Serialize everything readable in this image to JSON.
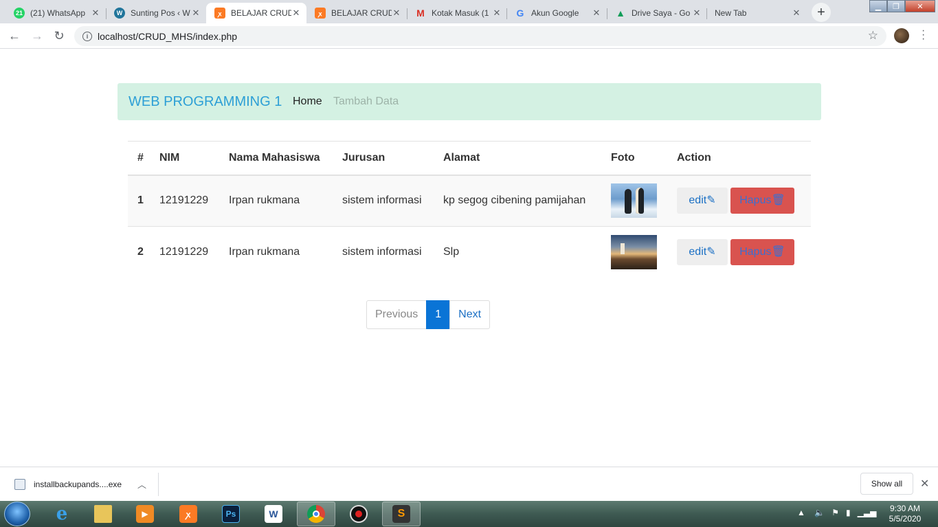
{
  "browser": {
    "tabs": [
      {
        "title": "(21) WhatsApp",
        "favicon": "whatsapp-icon",
        "color": "#25d366"
      },
      {
        "title": "Sunting Pos ‹ W",
        "favicon": "wordpress-icon",
        "color": "#21759b"
      },
      {
        "title": "BELAJAR CRUD",
        "favicon": "xampp-icon",
        "color": "#fb7a24",
        "active": true
      },
      {
        "title": "BELAJAR CRUD",
        "favicon": "xampp-icon",
        "color": "#fb7a24"
      },
      {
        "title": "Kotak Masuk (1",
        "favicon": "gmail-icon",
        "color": "#d93025"
      },
      {
        "title": "Akun Google",
        "favicon": "google-icon",
        "color": "#4285f4"
      },
      {
        "title": "Drive Saya - Go",
        "favicon": "drive-icon",
        "color": "#0f9d58"
      },
      {
        "title": "New Tab",
        "favicon": "",
        "color": ""
      }
    ],
    "url": "localhost/CRUD_MHS/index.php"
  },
  "navbar": {
    "brand": "WEB PROGRAMMING 1",
    "home": "Home",
    "tambah": "Tambah Data"
  },
  "table": {
    "headers": [
      "#",
      "NIM",
      "Nama Mahasiswa",
      "Jurusan",
      "Alamat",
      "Foto",
      "Action"
    ],
    "rows": [
      {
        "no": "1",
        "nim": "12191229",
        "nama": "Irpan rukmana",
        "jurusan": "sistem informasi",
        "alamat": "kp segog cibening pamijahan",
        "foto": "penguins-photo"
      },
      {
        "no": "2",
        "nim": "12191229",
        "nama": "Irpan rukmana",
        "jurusan": "sistem informasi",
        "alamat": "Slp",
        "foto": "lighthouse-photo"
      }
    ],
    "edit_label": "edit",
    "hapus_label": "Hapus"
  },
  "pagination": {
    "previous": "Previous",
    "current": "1",
    "next": "Next"
  },
  "download": {
    "file": "installbackupands....exe",
    "show_all": "Show all"
  },
  "taskbar": {
    "time": "9:30 AM",
    "date": "5/5/2020"
  }
}
